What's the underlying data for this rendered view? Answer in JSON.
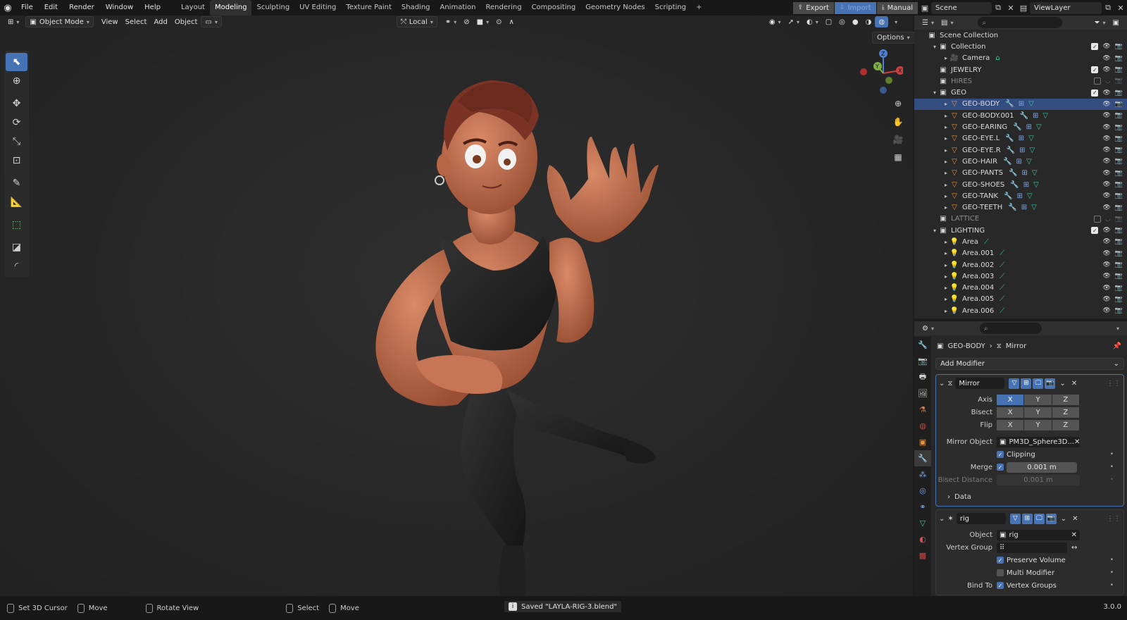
{
  "menu": [
    "File",
    "Edit",
    "Render",
    "Window",
    "Help"
  ],
  "workspaces": [
    "Layout",
    "Modeling",
    "Sculpting",
    "UV Editing",
    "Texture Paint",
    "Shading",
    "Animation",
    "Rendering",
    "Compositing",
    "Geometry Nodes",
    "Scripting"
  ],
  "workspace_active": "Modeling",
  "topright": {
    "export": "Export",
    "import": "Import",
    "manual": "Manual",
    "scene": "Scene",
    "viewlayer": "ViewLayer"
  },
  "viewport": {
    "mode": "Object Mode",
    "menus": [
      "View",
      "Select",
      "Add",
      "Object"
    ],
    "transform_orientation": "Local",
    "options": "Options"
  },
  "outliner": {
    "rows": [
      {
        "label": "Scene Collection",
        "indent": 0,
        "icon": "collection-icon",
        "exp": "",
        "vis": false
      },
      {
        "label": "Collection",
        "indent": 1,
        "icon": "collection-icon",
        "exp": "▾",
        "vis": true,
        "checked": true
      },
      {
        "label": "Camera",
        "indent": 2,
        "icon": "camera-icon",
        "exp": "▸",
        "vis": true,
        "mods": [
          "camera-data-icon"
        ]
      },
      {
        "label": "JEWELRY",
        "indent": 1,
        "icon": "collection-icon",
        "exp": "",
        "vis": true,
        "checked": true
      },
      {
        "label": "HIRES",
        "indent": 1,
        "icon": "collection-icon",
        "exp": "",
        "vis": true,
        "checked": false,
        "dim": true
      },
      {
        "label": "GEO",
        "indent": 1,
        "icon": "collection-icon",
        "exp": "▾",
        "vis": true,
        "checked": true
      },
      {
        "label": "GEO-BODY",
        "indent": 2,
        "icon": "mesh-icon",
        "exp": "▸",
        "vis": true,
        "sel": true,
        "mods": [
          "wrench-icon",
          "lattice-icon",
          "mesh-data-icon"
        ]
      },
      {
        "label": "GEO-BODY.001",
        "indent": 2,
        "icon": "mesh-icon",
        "exp": "▸",
        "vis": true,
        "mods": [
          "wrench-icon",
          "lattice-icon",
          "mesh-data-icon"
        ]
      },
      {
        "label": "GEO-EARING",
        "indent": 2,
        "icon": "mesh-icon",
        "exp": "▸",
        "vis": true,
        "mods": [
          "wrench-icon",
          "lattice-icon",
          "mesh-data-icon"
        ]
      },
      {
        "label": "GEO-EYE.L",
        "indent": 2,
        "icon": "mesh-icon",
        "exp": "▸",
        "vis": true,
        "mods": [
          "wrench-icon",
          "lattice-icon",
          "mesh-data-icon"
        ]
      },
      {
        "label": "GEO-EYE.R",
        "indent": 2,
        "icon": "mesh-icon",
        "exp": "▸",
        "vis": true,
        "mods": [
          "wrench-icon",
          "lattice-icon",
          "mesh-data-icon"
        ]
      },
      {
        "label": "GEO-HAIR",
        "indent": 2,
        "icon": "mesh-icon",
        "exp": "▸",
        "vis": true,
        "mods": [
          "wrench-icon",
          "lattice-icon",
          "mesh-data-icon"
        ]
      },
      {
        "label": "GEO-PANTS",
        "indent": 2,
        "icon": "mesh-icon",
        "exp": "▸",
        "vis": true,
        "mods": [
          "wrench-icon",
          "lattice-icon",
          "mesh-data-icon"
        ]
      },
      {
        "label": "GEO-SHOES",
        "indent": 2,
        "icon": "mesh-icon",
        "exp": "▸",
        "vis": true,
        "mods": [
          "wrench-icon",
          "lattice-icon",
          "mesh-data-icon"
        ]
      },
      {
        "label": "GEO-TANK",
        "indent": 2,
        "icon": "mesh-icon",
        "exp": "▸",
        "vis": true,
        "mods": [
          "wrench-icon",
          "lattice-icon",
          "mesh-data-icon"
        ]
      },
      {
        "label": "GEO-TEETH",
        "indent": 2,
        "icon": "mesh-icon",
        "exp": "▸",
        "vis": true,
        "mods": [
          "wrench-icon",
          "lattice-icon",
          "mesh-data-icon"
        ]
      },
      {
        "label": "LATTICE",
        "indent": 1,
        "icon": "collection-icon",
        "exp": "",
        "vis": true,
        "checked": false,
        "dim": true
      },
      {
        "label": "LIGHTING",
        "indent": 1,
        "icon": "collection-icon",
        "exp": "▾",
        "vis": true,
        "checked": true
      },
      {
        "label": "Area",
        "indent": 2,
        "icon": "light-icon",
        "exp": "▸",
        "vis": true,
        "mods": [
          "light-data-icon"
        ]
      },
      {
        "label": "Area.001",
        "indent": 2,
        "icon": "light-icon",
        "exp": "▸",
        "vis": true,
        "mods": [
          "light-data-icon"
        ]
      },
      {
        "label": "Area.002",
        "indent": 2,
        "icon": "light-icon",
        "exp": "▸",
        "vis": true,
        "mods": [
          "light-data-icon"
        ]
      },
      {
        "label": "Area.003",
        "indent": 2,
        "icon": "light-icon",
        "exp": "▸",
        "vis": true,
        "mods": [
          "light-data-icon"
        ]
      },
      {
        "label": "Area.004",
        "indent": 2,
        "icon": "light-icon",
        "exp": "▸",
        "vis": true,
        "mods": [
          "light-data-icon"
        ]
      },
      {
        "label": "Area.005",
        "indent": 2,
        "icon": "light-icon",
        "exp": "▸",
        "vis": true,
        "mods": [
          "light-data-icon"
        ]
      },
      {
        "label": "Area.006",
        "indent": 2,
        "icon": "light-icon",
        "exp": "▸",
        "vis": true,
        "mods": [
          "light-data-icon"
        ]
      }
    ]
  },
  "properties": {
    "breadcrumb_object": "GEO-BODY",
    "breadcrumb_modifier": "Mirror",
    "add_modifier": "Add Modifier",
    "mirror": {
      "name": "Mirror",
      "axis_label": "Axis",
      "bisect_label": "Bisect",
      "flip_label": "Flip",
      "axes": [
        "X",
        "Y",
        "Z"
      ],
      "mirror_object_label": "Mirror Object",
      "mirror_object": "PM3D_Sphere3D...",
      "clipping": "Clipping",
      "merge_label": "Merge",
      "merge_value": "0.001 m",
      "bisect_distance_label": "Bisect Distance",
      "bisect_distance_value": "0.001 m",
      "data": "Data"
    },
    "armature": {
      "name": "rig",
      "object_label": "Object",
      "object_value": "rig",
      "vertex_group_label": "Vertex Group",
      "preserve_volume": "Preserve Volume",
      "multi_modifier": "Multi Modifier",
      "bind_to_label": "Bind To",
      "vertex_groups": "Vertex Groups"
    }
  },
  "status": {
    "set_cursor": "Set 3D Cursor",
    "move": "Move",
    "rotate_view": "Rotate View",
    "select": "Select",
    "move2": "Move",
    "saved": "Saved \"LAYLA-RIG-3.blend\"",
    "version": "3.0.0"
  },
  "colors": {
    "accent": "#4772b3",
    "skin": "#c8714f",
    "hair": "#7a3325",
    "tank": "#1f1f1f"
  }
}
